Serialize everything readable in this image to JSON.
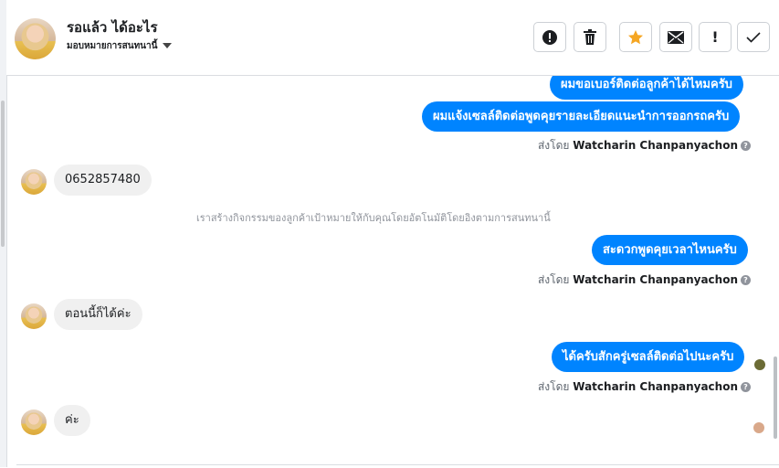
{
  "header": {
    "contact_name": "รอแล้ว ได้อะไร",
    "assign_label": "มอบหมายการสนทนานี้",
    "tools": [
      {
        "name": "alert-icon"
      },
      {
        "name": "trash-icon"
      },
      {
        "name": "star-icon",
        "color": "#f5a623"
      },
      {
        "name": "mail-icon"
      },
      {
        "name": "exclamation-icon",
        "label": "!"
      },
      {
        "name": "check-icon"
      }
    ]
  },
  "messages": {
    "out1": "ผมขอเบอร์ติดต่อลูกค้าได้ไหมครับ",
    "out2": "ผมแจ้งเซลล์ติดต่อพูดคุยรายละเอียดแนะนำการออกรถครับ",
    "in1": "0652857480",
    "system_note": "เราสร้างกิจกรรมของลูกค้าเป้าหมายให้กับคุณโดยอัตโนมัติโดยอิงตามการสนทนานี้",
    "out3": "สะดวกพูดคุยเวลาไหนครับ",
    "in2": "ตอนนี้ก็ได้ค่ะ",
    "out4": "ได้ครับสักครู่เซลล์ติดต่อไปนะครับ",
    "in3": "ค่ะ"
  },
  "sent_by": {
    "prefix": "ส่งโดย",
    "agent": "Watcharin Chanpanyachon",
    "help": "?"
  },
  "colors": {
    "bubble_out": "#0084ff",
    "bubble_in": "#f0f0f0"
  }
}
